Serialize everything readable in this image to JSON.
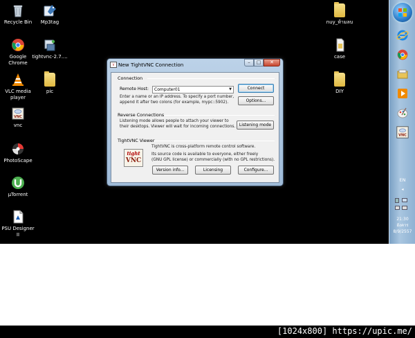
{
  "desktop": {
    "icons_left": [
      {
        "label": "Recycle Bin",
        "icon": "recycle-bin-icon"
      },
      {
        "label": "Mp3tag",
        "icon": "mp3tag-icon"
      },
      {
        "label": "Google Chrome",
        "icon": "chrome-icon"
      },
      {
        "label": "tightvnc-2.7....",
        "icon": "installer-icon"
      },
      {
        "label": "VLC media player",
        "icon": "vlc-icon"
      },
      {
        "label": "pic",
        "icon": "folder-icon"
      },
      {
        "label": "vnc",
        "icon": "vnc-icon"
      },
      {
        "label": "PhotoScape",
        "icon": "photoscape-icon"
      },
      {
        "label": "µTorrent",
        "icon": "utorrent-icon"
      },
      {
        "label": "PSU Designer II",
        "icon": "psu-designer-icon"
      }
    ],
    "icons_right": [
      {
        "label": "nuy_ห้ามลบ",
        "icon": "folder-icon"
      },
      {
        "label": "case",
        "icon": "file-icon"
      },
      {
        "label": "DIY",
        "icon": "folder-icon"
      }
    ]
  },
  "taskbar": {
    "items": [
      "start-orb-icon",
      "ie-icon",
      "chrome-icon",
      "explorer-icon",
      "media-player-icon",
      "paint-icon",
      "vnc-icon"
    ],
    "language": "EN",
    "clock_time": "21:30",
    "clock_day": "อังคาร",
    "clock_date": "8/9/2557"
  },
  "window": {
    "title": "New TightVNC Connection",
    "connection": {
      "heading": "Connection",
      "host_label": "Remote Host:",
      "host_value": "Computer01",
      "help_line1": "Enter a name or an IP address. To specify a port number,",
      "help_line2": "append it after two colons (for example, mypc::5902).",
      "connect_label": "Connect",
      "options_label": "Options..."
    },
    "reverse": {
      "heading": "Reverse Connections",
      "help_line1": "Listening mode allows people to attach your viewer to",
      "help_line2": "their desktops. Viewer will wait for incoming connections.",
      "listening_label": "Listening mode"
    },
    "viewer": {
      "heading": "TightVNC Viewer",
      "logo_top": "tight",
      "logo_bottom": "VNC",
      "line1": "TightVNC is cross-platform remote control software.",
      "line2": "Its source code is available to everyone, either freely",
      "line3": "(GNU GPL license) or commercially (with no GPL restrictions).",
      "version_label": "Version info...",
      "licensing_label": "Licensing",
      "configure_label": "Configure..."
    }
  },
  "footer": {
    "text": "[1024x800] https://upic.me/"
  }
}
